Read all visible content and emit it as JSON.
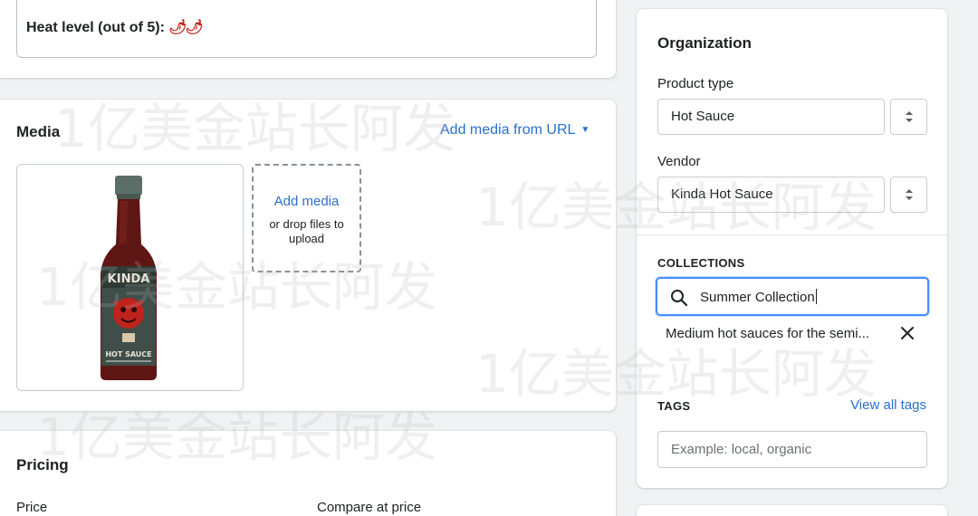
{
  "product": {
    "heat_label": "Heat level (out of 5):",
    "heat_value": "🌶🌶"
  },
  "media": {
    "title": "Media",
    "add_from_url": "Add media from URL",
    "add_media": "Add media",
    "drop_hint": "or drop files to upload",
    "image_alt": "Hot sauce bottle"
  },
  "pricing": {
    "title": "Pricing",
    "price_label": "Price",
    "compare_label": "Compare at price"
  },
  "organization": {
    "title": "Organization",
    "product_type_label": "Product type",
    "product_type_value": "Hot Sauce",
    "vendor_label": "Vendor",
    "vendor_value": "Kinda Hot Sauce",
    "collections_heading": "COLLECTIONS",
    "collections_search_value": "Summer Collection",
    "collection_selected": "Medium hot sauces for the semi...",
    "tags_heading": "TAGS",
    "view_all_tags": "View all tags",
    "tags_placeholder": "Example: local, organic"
  },
  "watermark": {
    "text": "1亿美金站长阿发"
  },
  "colors": {
    "accent": "#2c6ecb",
    "focus_ring": "#458fff",
    "background": "#f1f2f3"
  }
}
